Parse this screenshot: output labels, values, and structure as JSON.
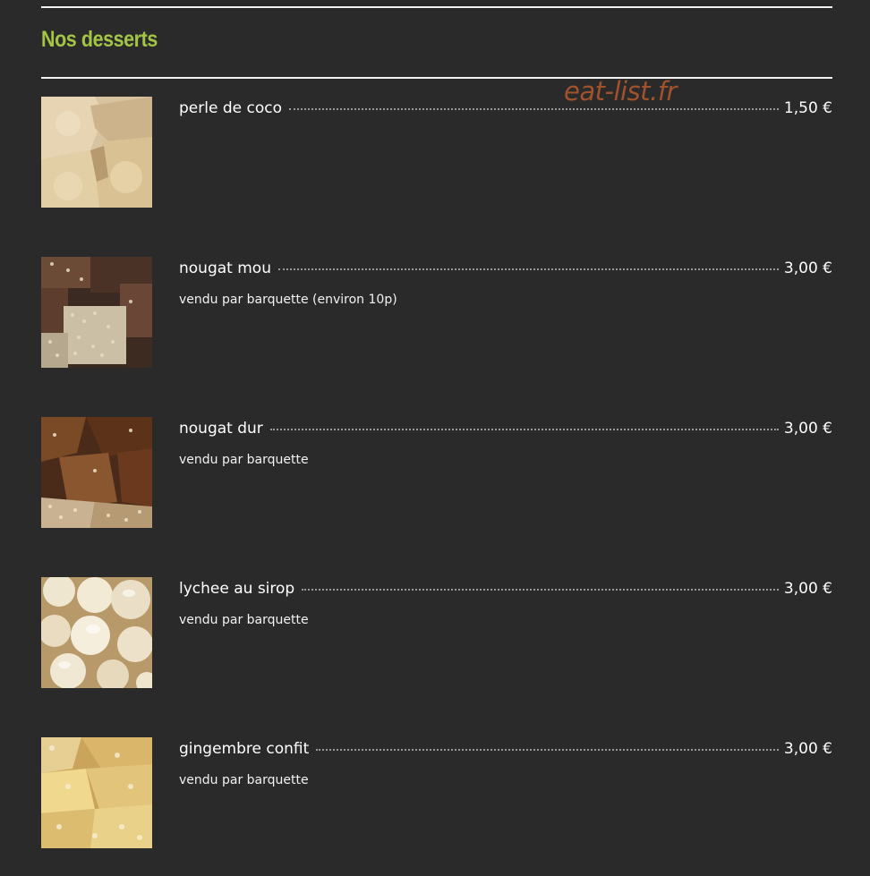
{
  "section": {
    "title": "Nos desserts"
  },
  "watermark": "eat-list.fr",
  "items": [
    {
      "name": "perle de coco",
      "price": "1,50 €",
      "description": ""
    },
    {
      "name": "nougat mou",
      "price": "3,00 €",
      "description": "vendu par barquette (environ 10p)"
    },
    {
      "name": "nougat dur",
      "price": "3,00 €",
      "description": "vendu par barquette"
    },
    {
      "name": "lychee au sirop",
      "price": "3,00 €",
      "description": "vendu par barquette"
    },
    {
      "name": "gingembre confit",
      "price": "3,00 €",
      "description": "vendu par barquette"
    }
  ],
  "colors": {
    "background": "#2a2a2a",
    "title_green": "#a3c545",
    "watermark": "#a0522d",
    "text": "#ffffff"
  }
}
